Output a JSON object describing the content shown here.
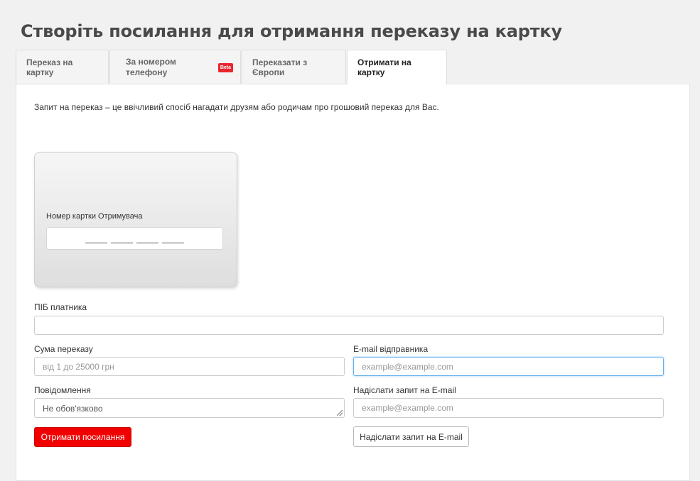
{
  "page": {
    "title": "Створіть посилання для отримання переказу на картку"
  },
  "tabs": [
    {
      "label": "Переказ на картку",
      "active": false
    },
    {
      "label": "За номером телефону",
      "badge": "Beta",
      "active": false
    },
    {
      "label": "Переказати з Європи",
      "active": false
    },
    {
      "label": "Отримати на картку",
      "active": true
    }
  ],
  "panel": {
    "intro": "Запит на переказ – це ввічливий спосіб нагадати друзям або родичам про грошовий переказ для Вас."
  },
  "card": {
    "label": "Номер картки Отримувача"
  },
  "form": {
    "payer_label": "ПІБ платника",
    "payer_value": "",
    "amount_label": "Сума переказу",
    "amount_placeholder": "від 1 до 25000 грн",
    "sender_email_label": "E-mail відправника",
    "sender_email_placeholder": "example@example.com",
    "message_label": "Повідомлення",
    "message_placeholder": "Не обов'язково",
    "request_email_label": "Надіслати запит на E-mail",
    "request_email_placeholder": "example@example.com",
    "get_link_button": "Отримати посилання",
    "send_request_button": "Надіслати запит на E-mail"
  },
  "colors": {
    "accent": "#f00000",
    "badge": "#e8262c",
    "focus": "#66afe9"
  }
}
